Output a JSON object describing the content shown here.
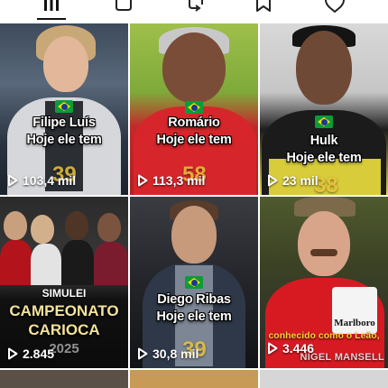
{
  "tabs": [
    {
      "icon": "grid-icon",
      "active": true
    },
    {
      "icon": "square-icon",
      "active": false
    },
    {
      "icon": "repost-icon",
      "active": false
    },
    {
      "icon": "bookmark-icon",
      "active": false
    },
    {
      "icon": "heart-icon",
      "active": false
    }
  ],
  "videos": [
    {
      "caption_line1": "Filipe Luís",
      "caption_line2": "Hoje ele tem",
      "number": "39",
      "views": "103,4 mil"
    },
    {
      "caption_line1": "Romário",
      "caption_line2": "Hoje ele tem",
      "number": "58",
      "views": "113,3 mil"
    },
    {
      "caption_line1": "Hulk",
      "caption_line2": "Hoje ele tem",
      "number": "38",
      "views": "23 mil"
    },
    {
      "overlay_top": "SIMULEI",
      "overlay_title_line1": "CAMPEONATO",
      "overlay_title_line2": "CARIOCA",
      "overlay_year": "2025",
      "views": "2.845"
    },
    {
      "caption_line1": "Diego Ribas",
      "caption_line2": "Hoje ele tem",
      "number": "39",
      "views": "30,8 mil"
    },
    {
      "overlay_text": "conhecido como o Leão,",
      "watermark": "NIGEL MANSELL",
      "sponsor": "Marlboro",
      "views": "3.446"
    }
  ],
  "colors": {
    "brazil_green": "#0c9b3a",
    "brazil_yellow": "#fedd00",
    "brazil_blue": "#1a3a93",
    "number_gold": "#e9c23c"
  }
}
